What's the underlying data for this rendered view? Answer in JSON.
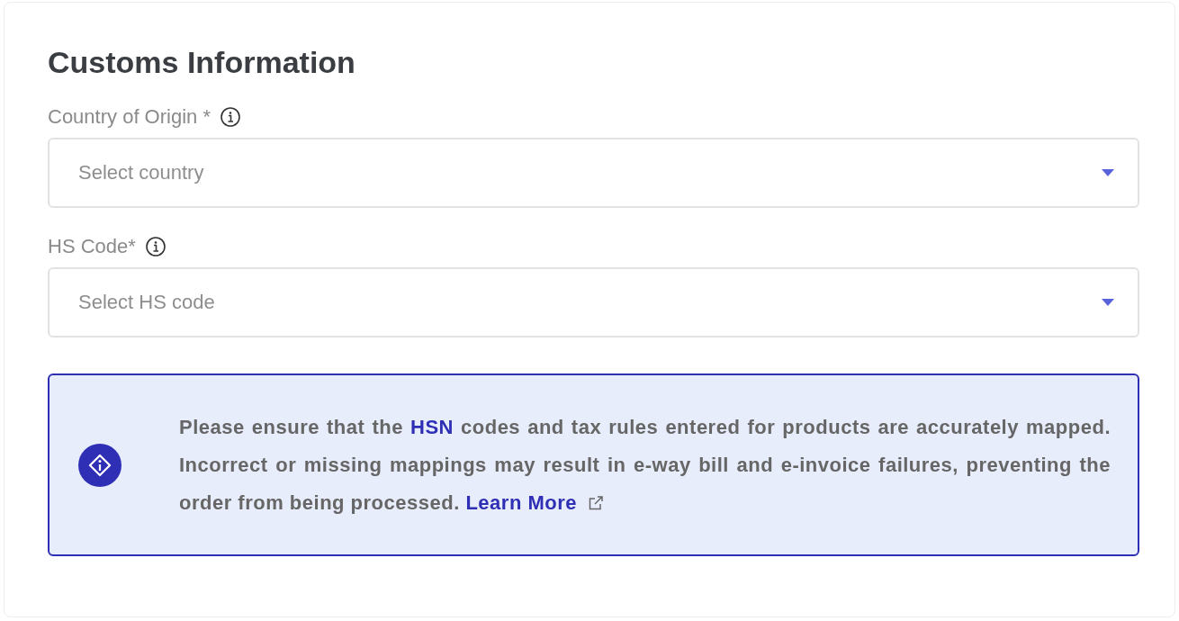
{
  "title": "Customs Information",
  "fields": [
    {
      "label": "Country of Origin *",
      "placeholder": "Select country"
    },
    {
      "label": "HS Code*",
      "placeholder": "Select HS code"
    }
  ],
  "notice": {
    "text_before": "Please ensure that the",
    "highlight": "HSN",
    "text_after": "codes and tax rules entered for products are accurately mapped. Incorrect or missing mappings may result in e-way bill and e-invoice failures, preventing the order from being processed.",
    "link": "Learn More"
  }
}
